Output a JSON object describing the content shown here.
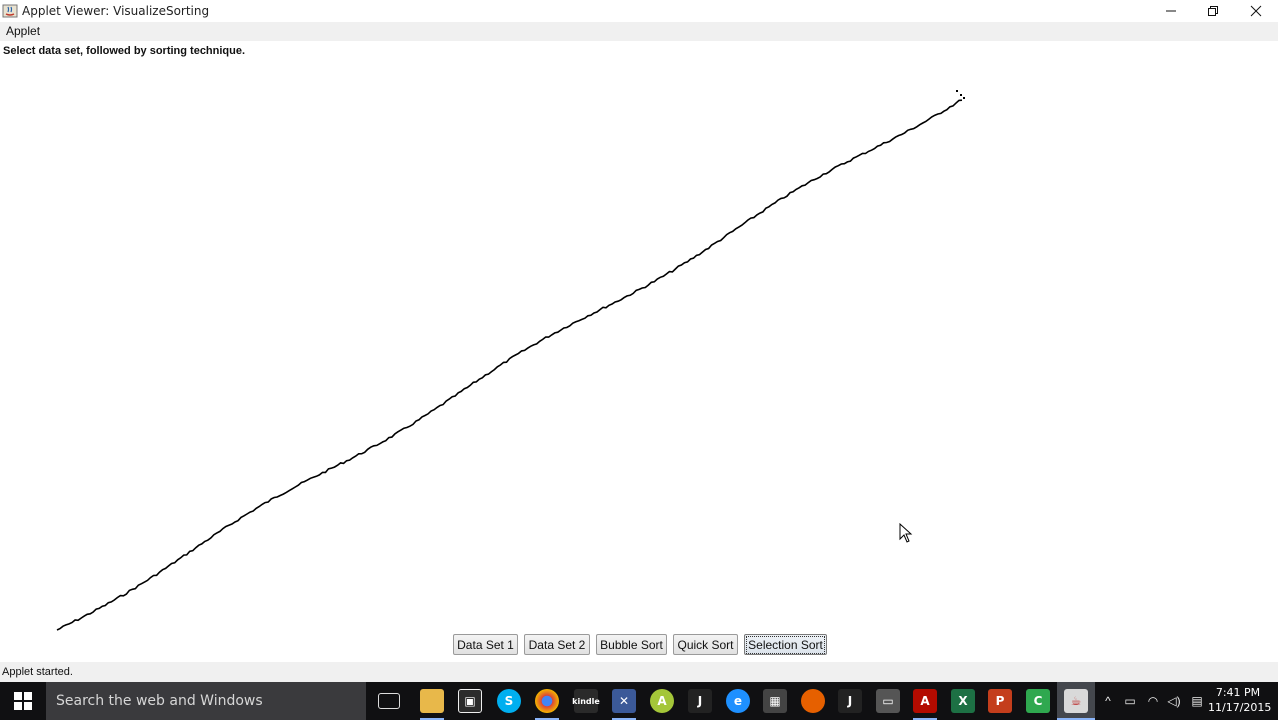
{
  "window": {
    "title": "Applet Viewer: VisualizeSorting"
  },
  "menu": {
    "applet_label": "Applet"
  },
  "applet": {
    "instruction": "Select data set, followed by sorting technique.",
    "buttons": [
      {
        "label": "Data Set 1",
        "focused": false
      },
      {
        "label": "Data Set 2",
        "focused": false
      },
      {
        "label": "Bubble Sort",
        "focused": false
      },
      {
        "label": "Quick Sort",
        "focused": false
      },
      {
        "label": "Selection Sort",
        "focused": true
      }
    ],
    "line_color": "#000000"
  },
  "status": {
    "text": "Applet started."
  },
  "taskbar": {
    "search_placeholder": "Search the web and Windows",
    "pinned_icons": [
      "task-view-icon",
      "file-explorer-icon",
      "store-icon",
      "skype-icon",
      "chrome-icon",
      "kindle-icon",
      "visual-studio-icon",
      "android-studio-icon",
      "intellij-icon",
      "edge-icon",
      "calculator-icon",
      "firefox-icon",
      "jetbrains-icon",
      "terminal-icon",
      "acrobat-icon",
      "excel-icon",
      "powerpoint-icon",
      "camtasia-icon",
      "java-icon"
    ],
    "clock_time": "7:41 PM",
    "clock_date": "11/17/2015",
    "accent": "#8ab4f8"
  }
}
